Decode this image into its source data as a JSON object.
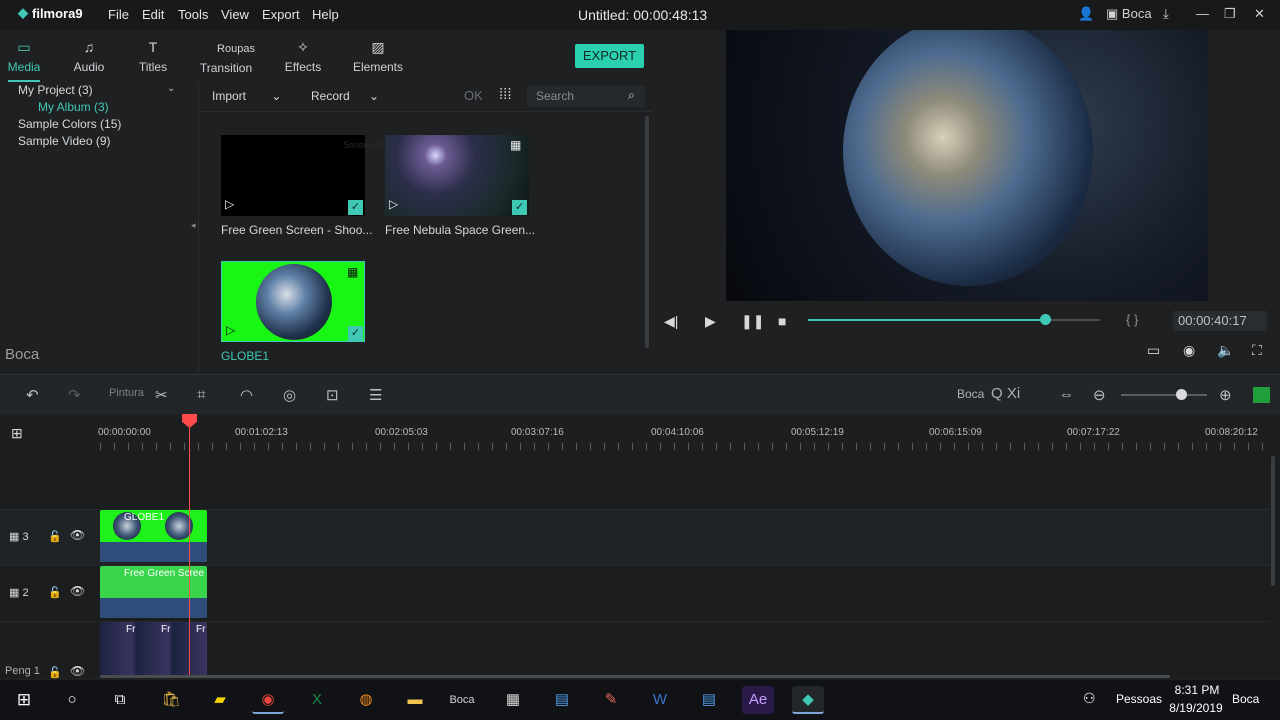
{
  "app": {
    "logo": "filmora9",
    "title": "Untitled:",
    "duration": "00:00:48:13"
  },
  "menu": [
    "File",
    "Edit",
    "Tools",
    "View",
    "Export",
    "Help"
  ],
  "window": {
    "user_label": "Boca"
  },
  "tabs": {
    "media": "Media",
    "audio": "Audio",
    "titles": "Titles",
    "roupas": "Roupas",
    "transition": "Transition",
    "effects": "Effects",
    "elements": "Elements"
  },
  "export_label": "EXPORT",
  "left_panel": {
    "items": [
      "My Project (3)",
      "My Album (3)",
      "Sample Colors (15)",
      "Sample Video (9)"
    ],
    "bottom_label": "Boca"
  },
  "media_toolbar": {
    "import": "Import",
    "record": "Record",
    "ok": "OK",
    "search_placeholder": "Search"
  },
  "media": [
    {
      "caption": "Free Green Screen - Shoo...",
      "watermark": "Sonolento"
    },
    {
      "caption": "Free Nebula Space Green..."
    },
    {
      "caption": "GLOBE1"
    }
  ],
  "player": {
    "timecode": "00:00:40:17",
    "brackets": "{    }",
    "progress": 0.81
  },
  "edit_toolbar": {
    "pintura": "Pintura",
    "boca": "Boca",
    "qxi": "Q Xi",
    "zoom": 0.7
  },
  "ruler": [
    "00:00:00:00",
    "00:01:02:13",
    "00:02:05:03",
    "00:03:07:16",
    "00:04:10:06",
    "00:05:12:19",
    "00:06:15:09",
    "00:07:17:22",
    "00:08:20:12"
  ],
  "tracks": [
    {
      "num": "3",
      "clip": "GLOBE1"
    },
    {
      "num": "2",
      "clip": "Free Green Scree"
    },
    {
      "num": "",
      "clip": "Fr"
    }
  ],
  "track_bottom_label": "Peng 1",
  "taskbar": {
    "pessoas": "Pessoas",
    "time": "8:31 PM",
    "date": "8/19/2019",
    "lang": "Boca",
    "boca_tile": "Boca"
  }
}
